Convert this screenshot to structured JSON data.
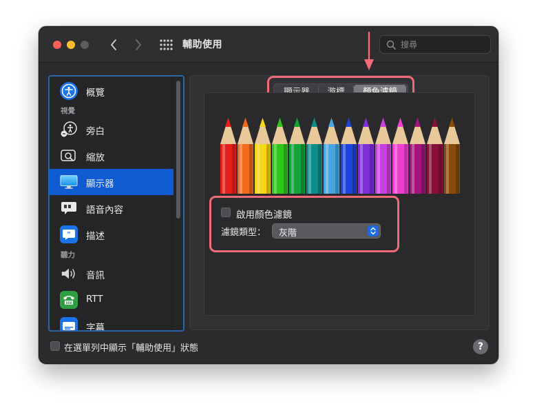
{
  "window": {
    "title": "輔助使用"
  },
  "search": {
    "placeholder": "搜尋"
  },
  "sidebar": {
    "items": [
      {
        "label": "概覽",
        "icon": "accessibility-icon",
        "color": "#1a73e8"
      },
      {
        "section": "視覺"
      },
      {
        "label": "旁白",
        "icon": "voiceover-icon",
        "color": "#2c2b2e"
      },
      {
        "label": "縮放",
        "icon": "zoom-icon",
        "color": "#2c2b2e"
      },
      {
        "label": "顯示器",
        "icon": "display-icon",
        "color": "#1a9bf0",
        "selected": true
      },
      {
        "label": "語音內容",
        "icon": "speech-bubble-icon",
        "color": "#3a393c"
      },
      {
        "label": "描述",
        "icon": "descriptions-icon",
        "color": "#1a73e8"
      },
      {
        "section": "聽力"
      },
      {
        "label": "音訊",
        "icon": "speaker-icon",
        "color": "#2c2b2e"
      },
      {
        "label": "RTT",
        "icon": "rtt-phone-icon",
        "color": "#2ea043"
      },
      {
        "label": "字幕",
        "icon": "captions-icon",
        "color": "#1a73e8"
      }
    ]
  },
  "tabs": [
    {
      "label": "顯示器"
    },
    {
      "label": "游標"
    },
    {
      "label": "顏色濾鏡",
      "selected": true
    }
  ],
  "color_filter": {
    "enable_label": "啟用顏色濾鏡",
    "enabled": false,
    "filter_type_label": "濾鏡類型：",
    "filter_type_value": "灰階"
  },
  "bottom": {
    "menu_bar_label": "在選單列中顯示「輔助使用」狀態",
    "help_label": "?"
  },
  "colors": {
    "accent": "#0f5bd2",
    "annotation": "#f06b78",
    "pencils": [
      "#e8201c",
      "#f26a1b",
      "#f6d514",
      "#2ec719",
      "#13a33a",
      "#0d8c8c",
      "#4aa6e0",
      "#1c44d8",
      "#7c2fd6",
      "#c93fe0",
      "#ee3fd0",
      "#a8147e",
      "#8a0e3a",
      "#8a4a0a"
    ]
  }
}
